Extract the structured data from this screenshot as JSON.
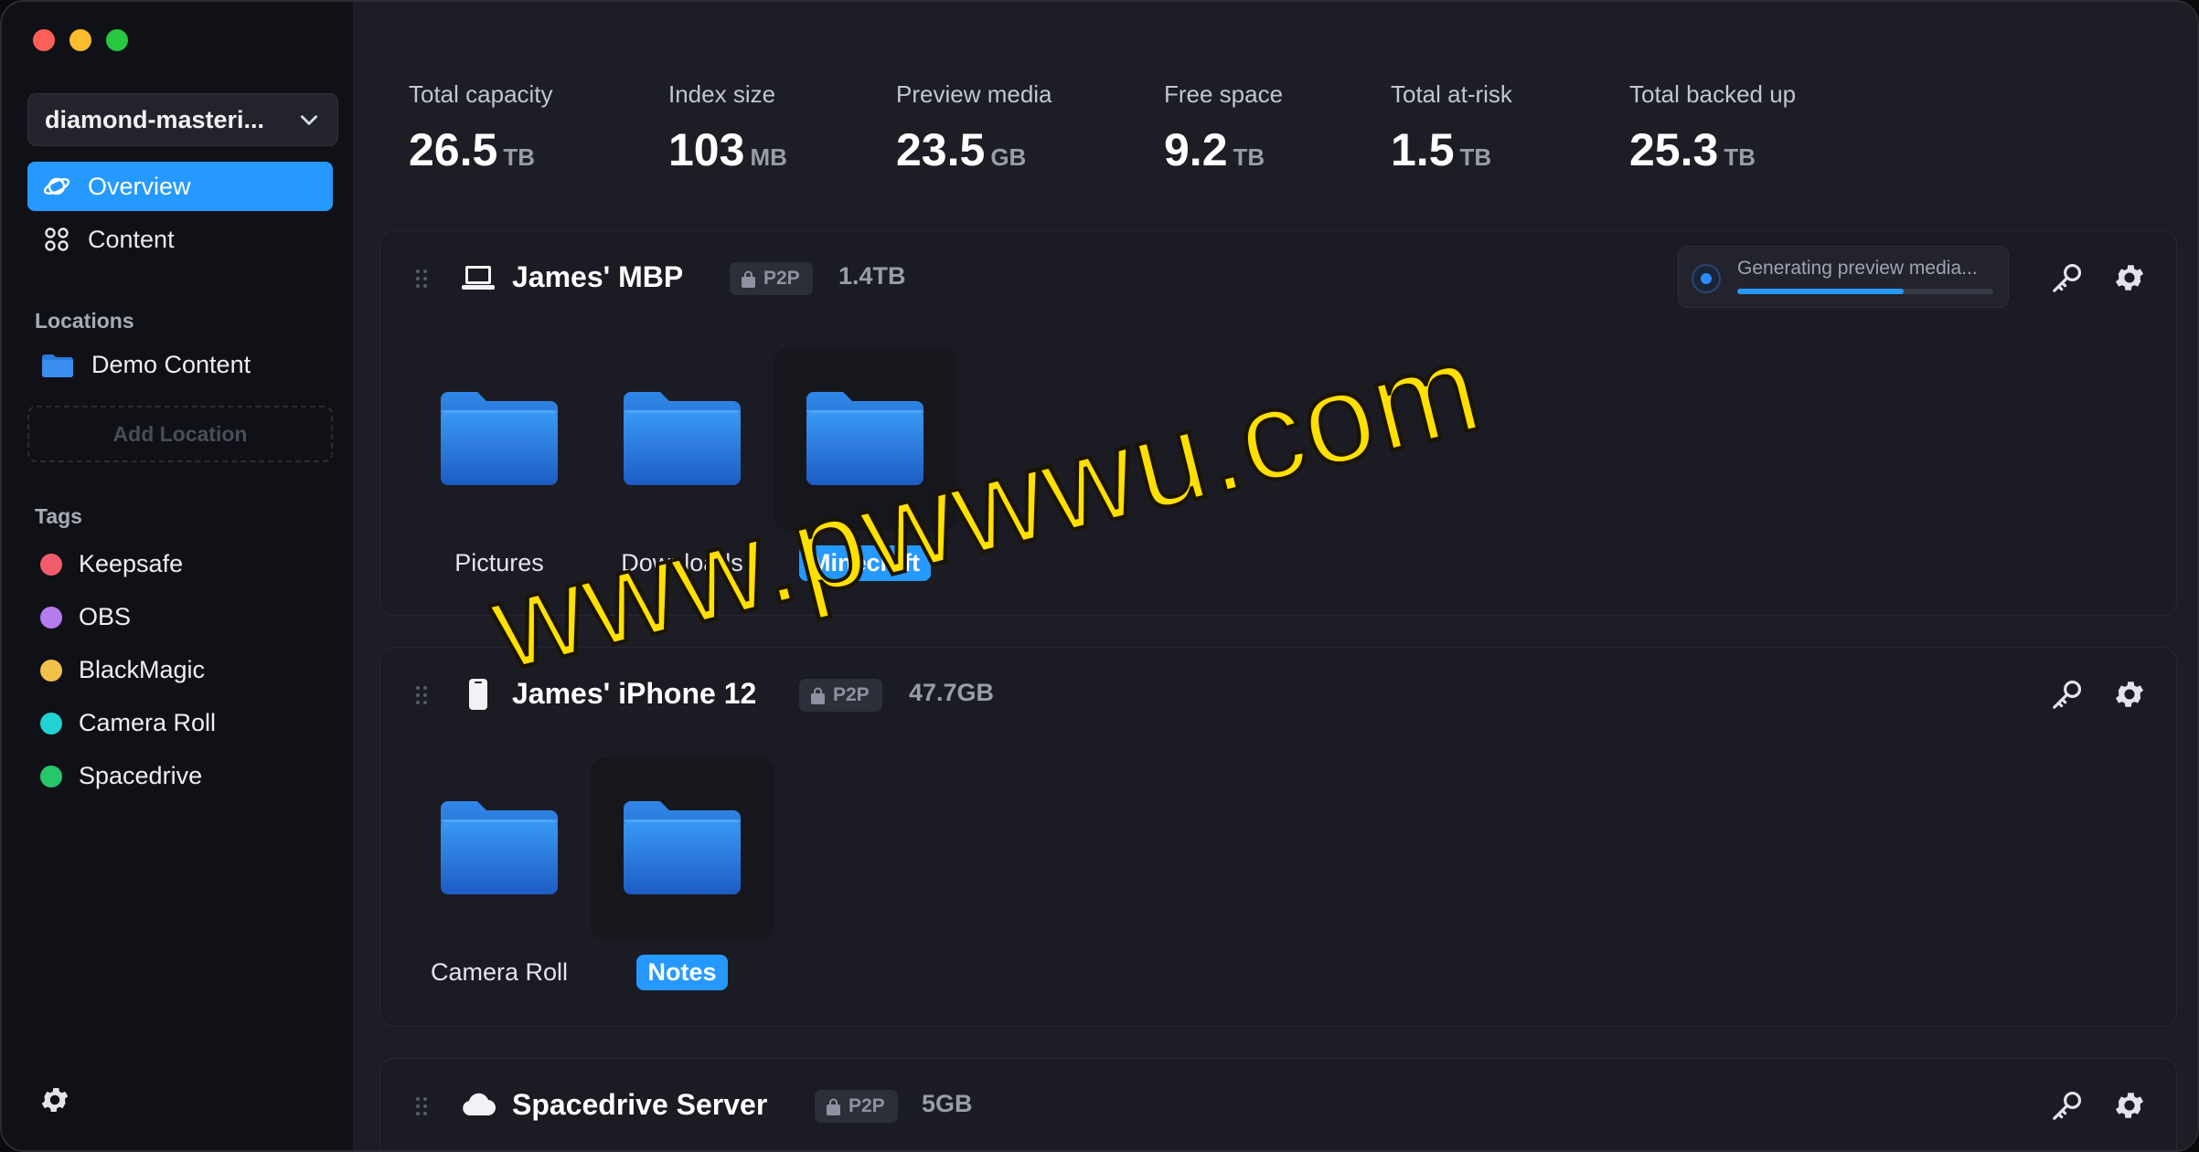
{
  "sidebar": {
    "library_name": "diamond-masteri...",
    "nav": [
      {
        "label": "Overview",
        "icon": "planet-icon",
        "active": true
      },
      {
        "label": "Content",
        "icon": "grid-icon",
        "active": false
      }
    ],
    "locations_title": "Locations",
    "locations": [
      {
        "label": "Demo Content"
      }
    ],
    "add_location_label": "Add Location",
    "tags_title": "Tags",
    "tags": [
      {
        "label": "Keepsafe",
        "color": "#f25b6b"
      },
      {
        "label": "OBS",
        "color": "#b57cf0"
      },
      {
        "label": "BlackMagic",
        "color": "#f2c14a"
      },
      {
        "label": "Camera Roll",
        "color": "#21d2d2"
      },
      {
        "label": "Spacedrive",
        "color": "#25c76b"
      }
    ]
  },
  "stats": [
    {
      "label": "Total capacity",
      "value": "26.5",
      "unit": "TB"
    },
    {
      "label": "Index size",
      "value": "103",
      "unit": "MB"
    },
    {
      "label": "Preview media",
      "value": "23.5",
      "unit": "GB"
    },
    {
      "label": "Free space",
      "value": "9.2",
      "unit": "TB"
    },
    {
      "label": "Total at-risk",
      "value": "1.5",
      "unit": "TB"
    },
    {
      "label": "Total backed up",
      "value": "25.3",
      "unit": "TB"
    }
  ],
  "devices": [
    {
      "name": "James' MBP",
      "icon": "laptop-icon",
      "badge": "P2P",
      "size": "1.4TB",
      "job": {
        "text": "Generating preview media...",
        "progress": 0.65
      },
      "folders": [
        {
          "label": "Pictures",
          "selected": false
        },
        {
          "label": "Downloads",
          "selected": false
        },
        {
          "label": "Minecraft",
          "selected": true
        }
      ]
    },
    {
      "name": "James' iPhone 12",
      "icon": "phone-icon",
      "badge": "P2P",
      "size": "47.7GB",
      "folders": [
        {
          "label": "Camera Roll",
          "selected": false
        },
        {
          "label": "Notes",
          "selected": true
        }
      ]
    },
    {
      "name": "Spacedrive Server",
      "icon": "cloud-icon",
      "badge": "P2P",
      "size": "5GB",
      "folders": []
    }
  ],
  "watermark": "www.pwwwu.com",
  "colors": {
    "accent": "#2599ff",
    "watermark": "#ffe000"
  }
}
